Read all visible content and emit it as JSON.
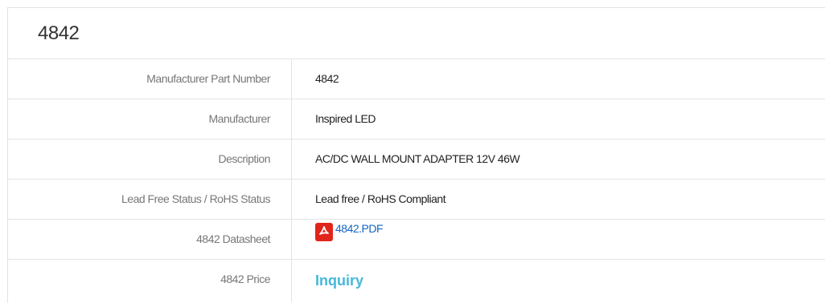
{
  "header": {
    "title": "4842"
  },
  "rows": [
    {
      "label": "Manufacturer Part Number",
      "value": "4842"
    },
    {
      "label": "Manufacturer",
      "value": "Inspired LED"
    },
    {
      "label": "Description",
      "value": "AC/DC WALL MOUNT ADAPTER 12V 46W"
    },
    {
      "label": "Lead Free Status / RoHS Status",
      "value": "Lead free / RoHS Compliant"
    },
    {
      "label": "4842 Datasheet",
      "value": "4842.PDF",
      "icon": "pdf-icon"
    },
    {
      "label": "4842 Price",
      "value": "Inquiry"
    }
  ],
  "colors": {
    "link": "#1565c0",
    "inquiry": "#46b8da",
    "pdf_icon": "#e1251b",
    "border": "#e3e3e3"
  }
}
